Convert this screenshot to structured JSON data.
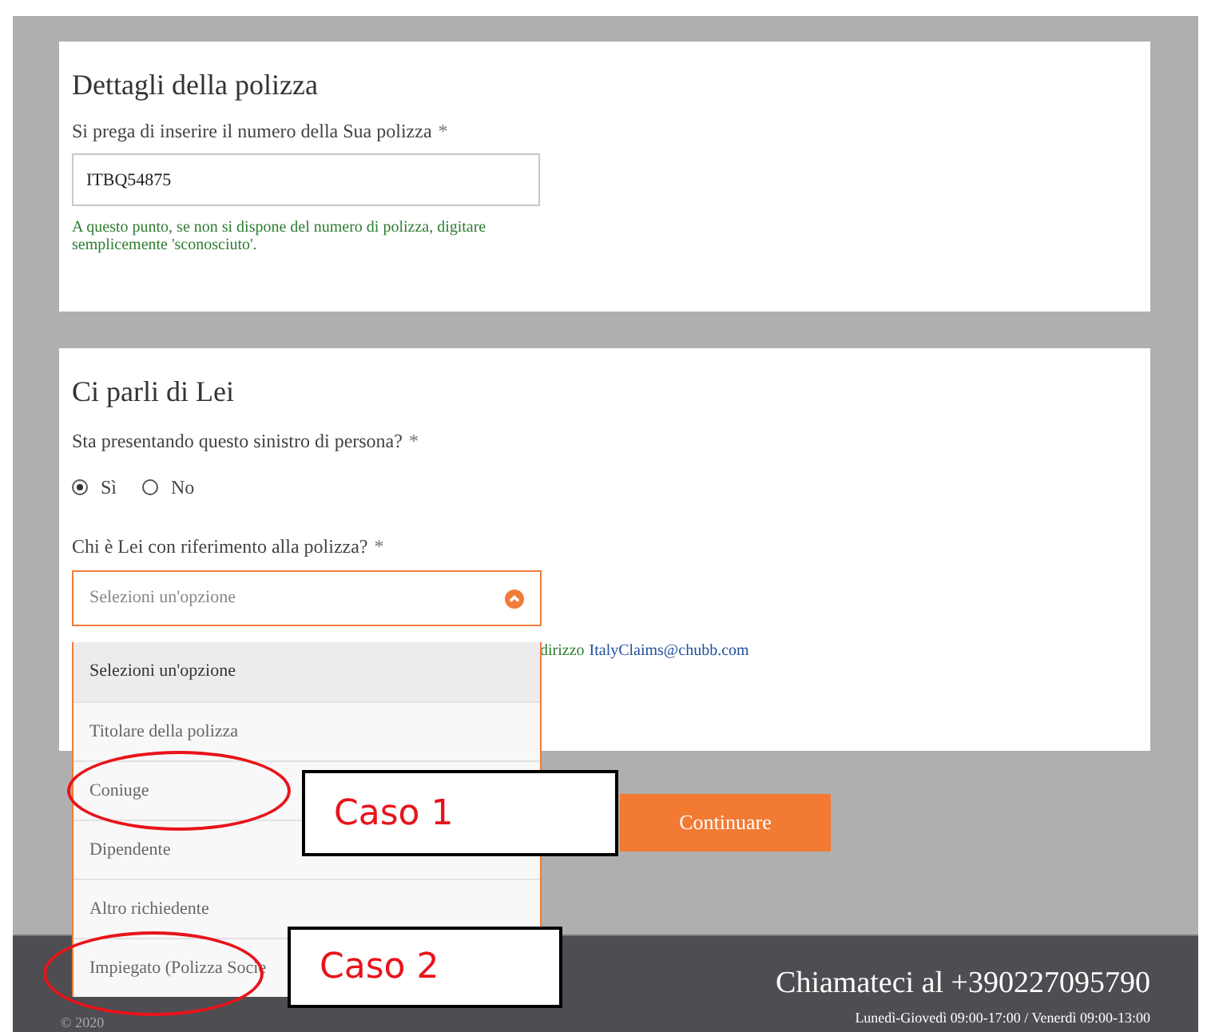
{
  "policy_section": {
    "title": "Dettagli della polizza",
    "label": "Si prega di inserire il numero della Sua polizza",
    "required_mark": "*",
    "value": "ITBQ54875",
    "help": "A questo punto, se non si dispone del numero di polizza, digitare semplicemente 'sconosciuto'."
  },
  "about_section": {
    "title": "Ci parli di Lei",
    "question": "Sta presentando questo sinistro di persona?",
    "required_mark": "*",
    "radios": [
      {
        "label": "Sì",
        "selected": true
      },
      {
        "label": "No",
        "selected": false
      }
    ],
    "role_question": "Chi è Lei con riferimento alla polizza?",
    "role_required_mark": "*",
    "select": {
      "placeholder": "Selezioni un'opzione",
      "expanded": true,
      "options": [
        {
          "label": "Selezioni un'opzione",
          "selected": true
        },
        {
          "label": "Titolare della polizza",
          "selected": false
        },
        {
          "label": "Coniuge",
          "selected": false
        },
        {
          "label": "Dipendente",
          "selected": false
        },
        {
          "label": "Altro richiedente",
          "selected": false
        },
        {
          "label": "Impiegato (Polizza Socie",
          "selected": false
        }
      ]
    },
    "note_tail": "dirizzo",
    "note_email": "ItalyClaims@chubb.com"
  },
  "continue_button": "Continuare",
  "footer": {
    "copyright": "© 2020",
    "phone": "Chiamateci al +390227095790",
    "hours": "Lunedì-Giovedì 09:00-17:00 / Venerdì 09:00-13:00"
  },
  "annotations": [
    {
      "label": "Caso 1"
    },
    {
      "label": "Caso 2"
    }
  ]
}
